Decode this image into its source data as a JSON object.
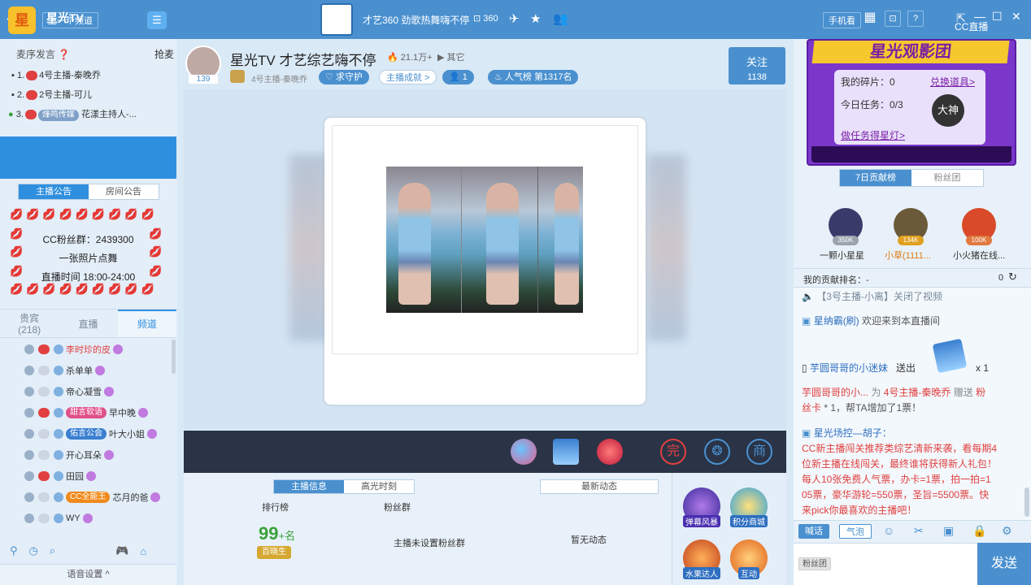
{
  "topbar": {
    "back": "‹",
    "prev_channel": "上一个频道",
    "logo_text": "360",
    "title": "才艺360 劲歌热舞嗨不停",
    "room_count": "360",
    "phone_view": "手机看",
    "help": "?",
    "brand": "CC直播",
    "minimize": "—",
    "maximize": "☐",
    "close": "✕"
  },
  "seats": {
    "header": "麦序发言",
    "grab": "抢麦",
    "rows": [
      {
        "num": "1.",
        "name": "4号主播-秦晚乔"
      },
      {
        "num": "2.",
        "name": "2号主播-可儿"
      },
      {
        "num": "3.",
        "name": "花漾主持人-..."
      }
    ],
    "tag3": "烽鸣传媒"
  },
  "channel": {
    "logo": "星",
    "name": "星光TV",
    "tabs": [
      "主播公告",
      "房间公告"
    ],
    "lips": "💋💋💋💋💋💋💋💋💋",
    "lines": [
      "CC粉丝群：2439300",
      "一张照片点舞",
      "直播时间 18:00-24:00"
    ]
  },
  "member_tabs": {
    "guests_label": "贵宾",
    "guests_count": "(218)",
    "live": "直播",
    "channel": "频道"
  },
  "members": [
    {
      "name": "李时珍的皮",
      "tag": "",
      "tag_color": "",
      "name_color": "#e04040"
    },
    {
      "name": "杀单单",
      "tag": "",
      "tag_color": "",
      "name_color": "#333"
    },
    {
      "name": "帝心凝雪",
      "tag": "",
      "tag_color": "",
      "name_color": "#333"
    },
    {
      "name": "早中晚",
      "tag": "甜言软语",
      "tag_color": "#e0508a",
      "name_color": "#333"
    },
    {
      "name": "叶大小姐",
      "tag": "佑言公会",
      "tag_color": "#3a7fd0",
      "name_color": "#333"
    },
    {
      "name": "开心耳朵",
      "tag": "",
      "tag_color": "",
      "name_color": "#333"
    },
    {
      "name": "田园",
      "tag": "",
      "tag_color": "",
      "name_color": "#333"
    },
    {
      "name": "芯月的爸",
      "tag": "CC全能王",
      "tag_color": "#f08a1c",
      "name_color": "#333"
    },
    {
      "name": "WY",
      "tag": "",
      "tag_color": "",
      "name_color": "#333"
    }
  ],
  "left_footer": {
    "voice_settings": "语音设置 ^"
  },
  "room": {
    "fans": "139",
    "title": "星光TV 才艺综艺嗨不停",
    "heat": "21.1万+",
    "other": "其它",
    "host": "4号主播-秦晚乔",
    "guard": "求守护",
    "achievement": "主播成就 >",
    "viewers": "1",
    "popularity": "人气榜 第1317名",
    "follow": "关注",
    "follow_count": "1138"
  },
  "info_tabs": [
    "主播信息",
    "高光时刻"
  ],
  "latest_news": "最新动态",
  "info": {
    "rank_label": "排行榜",
    "fan_group_label": "粉丝群",
    "rank_num": "99",
    "rank_suffix": "+名",
    "rank_badge": "百晓生",
    "fan_group_value": "主播未设置粉丝群",
    "news_value": "暂无动态"
  },
  "gift_bar_labels": [
    "完",
    "❂",
    "商"
  ],
  "side_gifts": [
    "弹幕风暴",
    "积分商城",
    "水果达人",
    "互动"
  ],
  "banner": {
    "title": "星光观影团",
    "fragments": "我的碎片：0",
    "exchange": "兑换道具>",
    "task": "今日任务：0/3",
    "do_task": "做任务得星灯>",
    "badge": "大神"
  },
  "rank_tabs": [
    "7日贡献榜",
    "粉丝团"
  ],
  "top_fans": [
    {
      "name": "一颗小星星",
      "badge": "350K",
      "color": "#3b3b6b",
      "name_color": "#333",
      "badge_color": "#9aa3ae"
    },
    {
      "name": "小草(1111...",
      "badge": "134K",
      "color": "#6b5a3a",
      "name_color": "#e07a10",
      "badge_color": "#e0a020"
    },
    {
      "name": "小火猪在线...",
      "badge": "100K",
      "color": "#d84a2a",
      "name_color": "#333",
      "badge_color": "#e07a40"
    }
  ],
  "my_rank": {
    "label": "我的贡献排名：-",
    "value": "0"
  },
  "chat": {
    "sys1": "【3号主播-小离】关闭了视频",
    "user1": "星纳霸(刷)",
    "welcome": "欢迎来到本直播间",
    "sender": "芋圆哥哥的小迷妹",
    "sent": "送出",
    "times": "x 1",
    "l1a": "芋圆哥哥的小...",
    "l1b": "为",
    "l1c": "4号主播-秦晚乔",
    "l1d": "赠送",
    "l1e": "粉",
    "l2a": "丝卡",
    "l2b": "* 1，帮TA增加了1票！",
    "host_name": "星光场控—胡子：",
    "lines": [
      "CC新主播闯关推荐类综艺清新来袭，看每期4",
      "位新主播在线闯关，最终谁将获得新人礼包！",
      "每人10张免费人气票，办卡=1票，拍一拍=1",
      "05票，豪华游轮=550票，圣旨=5500票。快",
      "来pick你最喜欢的主播吧！"
    ]
  },
  "chat_tools": {
    "shout": "喊话",
    "bubble": "气泡"
  },
  "input": {
    "fan_chip": "粉丝团",
    "send": "发送"
  }
}
